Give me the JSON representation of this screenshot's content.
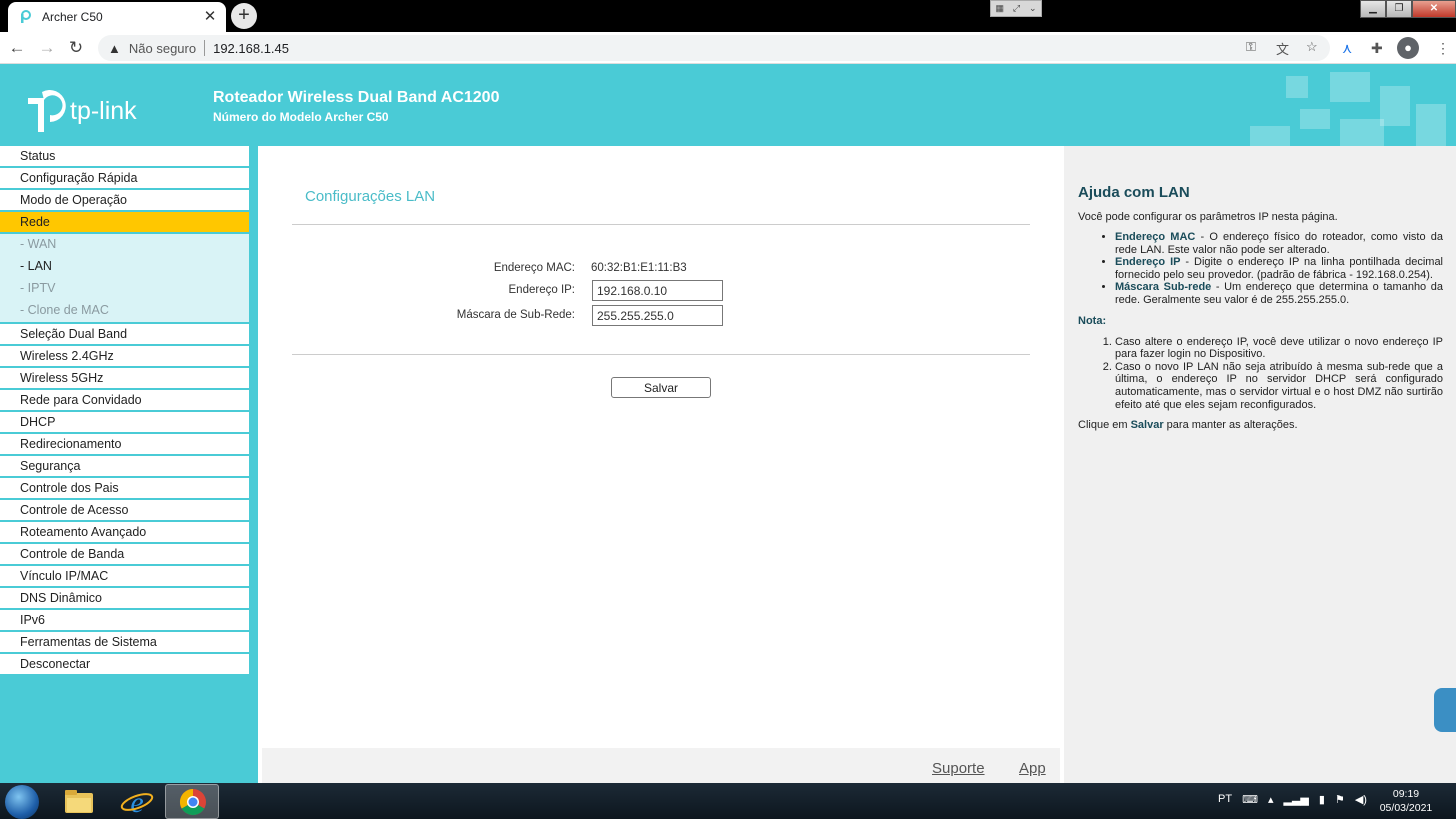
{
  "browser": {
    "tab_title": "Archer C50",
    "new_tab": "+",
    "not_secure": "Não seguro",
    "url": "192.168.1.45"
  },
  "router": {
    "logo_text": "tp-link",
    "product_title": "Roteador Wireless Dual Band AC1200",
    "model": "Número do Modelo Archer C50"
  },
  "sidebar": {
    "items": [
      {
        "label": "Status"
      },
      {
        "label": "Configuração Rápida"
      },
      {
        "label": "Modo de Operação"
      },
      {
        "label": "Rede"
      },
      {
        "label": "- WAN"
      },
      {
        "label": "- LAN"
      },
      {
        "label": "- IPTV"
      },
      {
        "label": "- Clone de MAC"
      },
      {
        "label": "Seleção Dual Band"
      },
      {
        "label": "Wireless 2.4GHz"
      },
      {
        "label": "Wireless 5GHz"
      },
      {
        "label": "Rede para Convidado"
      },
      {
        "label": "DHCP"
      },
      {
        "label": "Redirecionamento"
      },
      {
        "label": "Segurança"
      },
      {
        "label": "Controle dos Pais"
      },
      {
        "label": "Controle de Acesso"
      },
      {
        "label": "Roteamento Avançado"
      },
      {
        "label": "Controle de Banda"
      },
      {
        "label": "Vínculo IP/MAC"
      },
      {
        "label": "DNS Dinâmico"
      },
      {
        "label": "IPv6"
      },
      {
        "label": "Ferramentas de Sistema"
      },
      {
        "label": "Desconectar"
      }
    ]
  },
  "content": {
    "title": "Configurações LAN",
    "mac_label": "Endereço MAC:",
    "mac_value": "60:32:B1:E1:11:B3",
    "ip_label": "Endereço IP:",
    "ip_value": "192.168.0.10",
    "mask_label": "Máscara de Sub-Rede:",
    "mask_value": "255.255.255.0",
    "save": "Salvar",
    "footer_support": "Suporte",
    "footer_app": "App"
  },
  "help": {
    "title": "Ajuda com LAN",
    "intro": "Você pode configurar os parâmetros IP nesta página.",
    "items": [
      {
        "term": "Endereço MAC",
        "text": " - O endereço físico do roteador, como visto da rede LAN. Este valor não pode ser alterado."
      },
      {
        "term": "Endereço IP",
        "text": " - Digite o endereço IP na linha pontilhada decimal fornecido pelo seu provedor. (padrão de fábrica - 192.168.0.254)."
      },
      {
        "term": "Máscara Sub-rede",
        "text": " - Um endereço que determina o tamanho da rede. Geralmente seu valor é de 255.255.255.0."
      }
    ],
    "note_title": "Nota:",
    "notes": [
      "Caso altere o endereço IP, você deve utilizar o novo endereço IP para fazer login no Dispositivo.",
      "Caso o novo IP LAN não seja atribuído à mesma sub-rede que a última, o endereço IP no servidor DHCP será configurado automaticamente, mas o servidor virtual e o host DMZ não surtirão efeito até que eles sejam reconfigurados."
    ],
    "footer_pre": "Clique em ",
    "footer_hl": "Salvar",
    "footer_post": " para manter as alterações."
  },
  "taskbar": {
    "lang": "PT",
    "time": "09:19",
    "date": "05/03/2021"
  },
  "colors": {
    "brand": "#4acbd6",
    "active_menu": "#ffc700"
  }
}
